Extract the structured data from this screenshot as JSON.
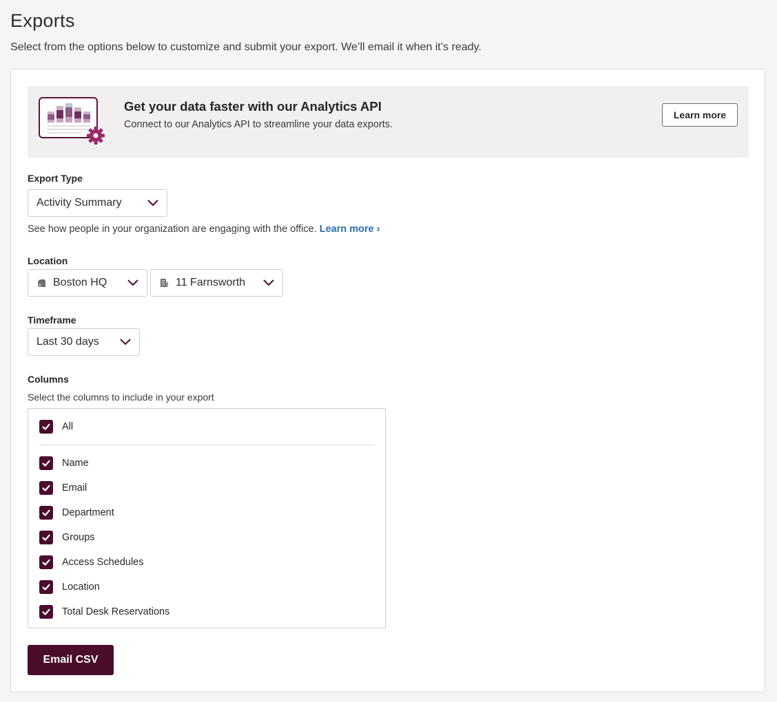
{
  "header": {
    "title": "Exports",
    "subtitle": "Select from the options below to customize and submit your export. We’ll email it when it’s ready."
  },
  "banner": {
    "heading": "Get your data faster with our Analytics API",
    "text": "Connect to our Analytics API to streamline your data exports.",
    "button_label": "Learn more"
  },
  "export_type": {
    "label": "Export Type",
    "selected": "Activity Summary",
    "description": "See how people in your organization are engaging with the office.",
    "link_label": "Learn more ›"
  },
  "location": {
    "label": "Location",
    "site": "Boston HQ",
    "site_icon": "location-pin-icon",
    "building": "11 Farnsworth",
    "building_icon": "building-icon"
  },
  "timeframe": {
    "label": "Timeframe",
    "selected": "Last 30 days"
  },
  "columns": {
    "label": "Columns",
    "description": "Select the columns to include in your export",
    "all_label": "All",
    "items": [
      {
        "label": "Name",
        "checked": true
      },
      {
        "label": "Email",
        "checked": true
      },
      {
        "label": "Department",
        "checked": true
      },
      {
        "label": "Groups",
        "checked": true
      },
      {
        "label": "Access Schedules",
        "checked": true
      },
      {
        "label": "Location",
        "checked": true
      },
      {
        "label": "Total Desk Reservations",
        "checked": true
      }
    ]
  },
  "submit_label": "Email CSV",
  "colors": {
    "brand": "#4a0d2b",
    "link": "#2f6fae",
    "background": "#f6f5f3",
    "banner_background": "#f1eff0"
  }
}
